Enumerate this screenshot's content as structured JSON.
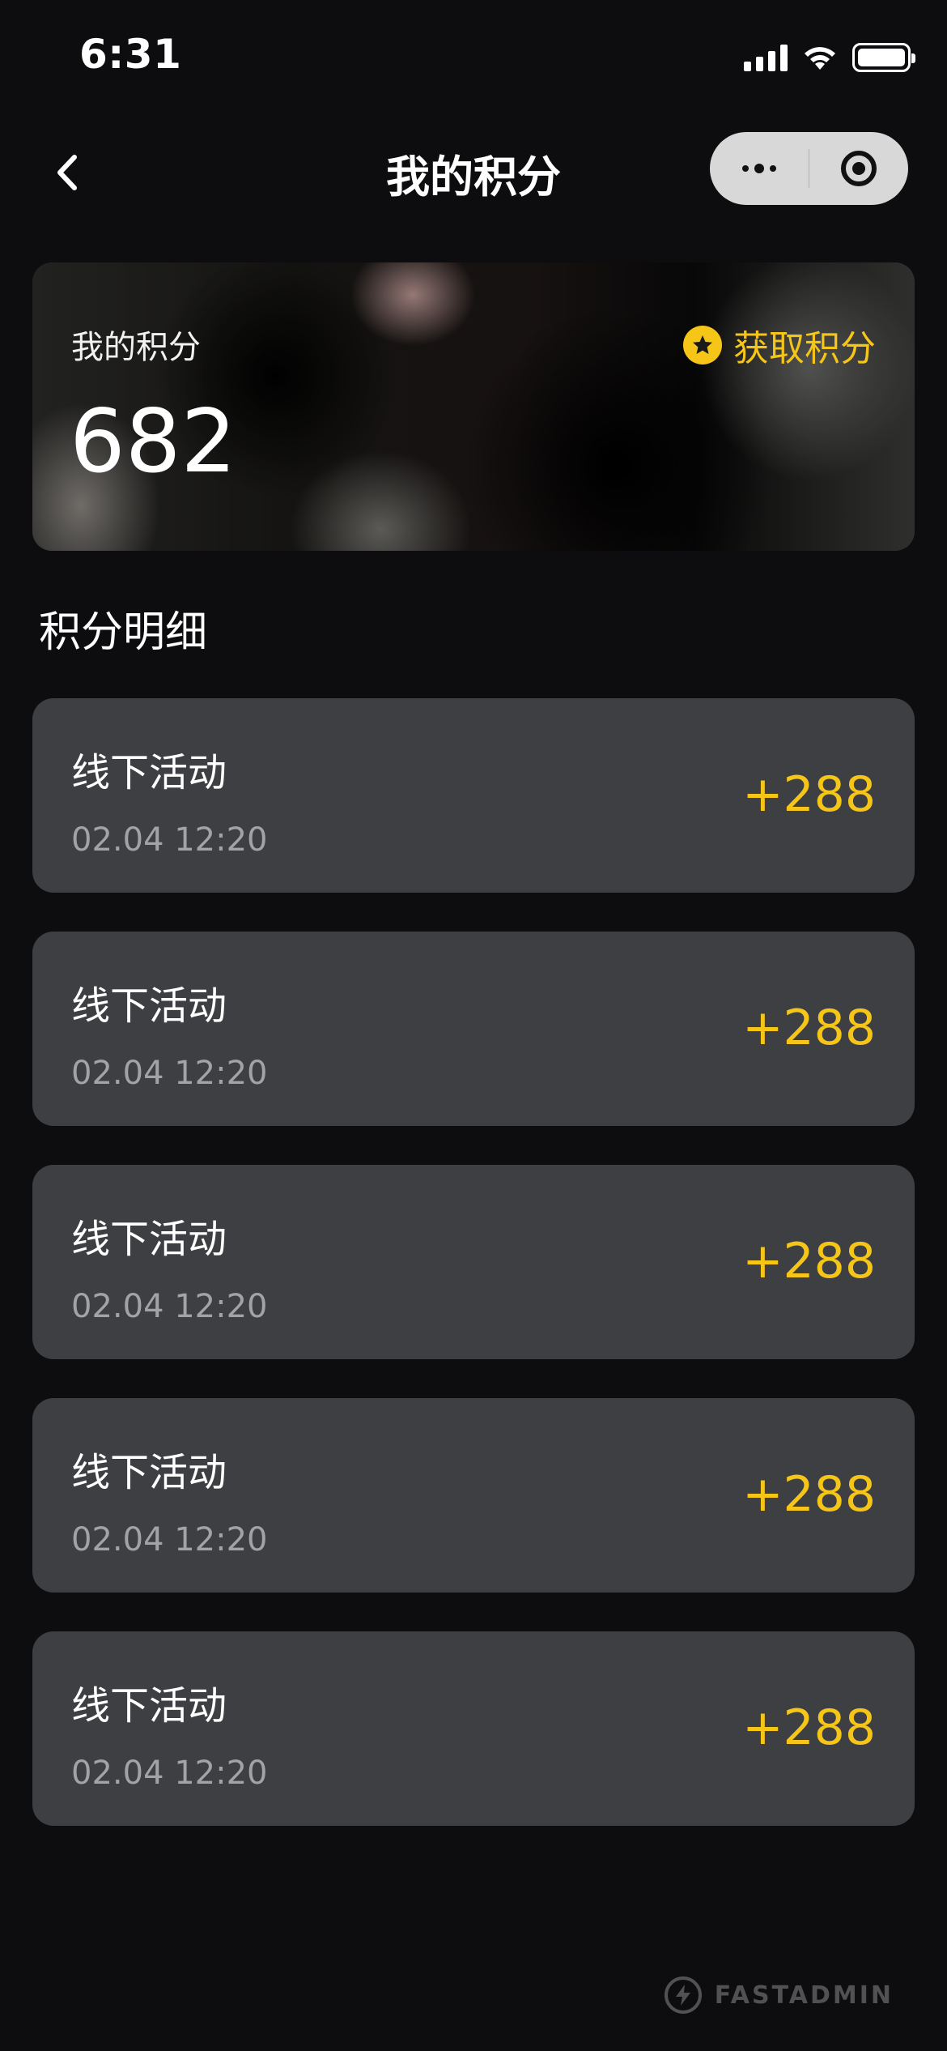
{
  "status_bar": {
    "time": "6:31"
  },
  "nav": {
    "title": "我的积分"
  },
  "points_card": {
    "label": "我的积分",
    "value": "682",
    "earn_label": "获取积分"
  },
  "section": {
    "title": "积分明细"
  },
  "records": [
    {
      "title": "线下活动",
      "time": "02.04 12:20",
      "points": "+288"
    },
    {
      "title": "线下活动",
      "time": "02.04 12:20",
      "points": "+288"
    },
    {
      "title": "线下活动",
      "time": "02.04 12:20",
      "points": "+288"
    },
    {
      "title": "线下活动",
      "time": "02.04 12:20",
      "points": "+288"
    },
    {
      "title": "线下活动",
      "time": "02.04 12:20",
      "points": "+288"
    }
  ],
  "watermark": {
    "text": "FASTADMIN"
  },
  "colors": {
    "background": "#0d0d0f",
    "card": "#3e3f42",
    "accent": "#f5c518",
    "muted_text": "#a3a3a6"
  },
  "icons": {
    "back": "chevron-left-icon",
    "more": "more-dots-icon",
    "close": "target-circle-icon",
    "earn": "star-badge-icon",
    "watermark": "lightning-bolt-icon"
  }
}
